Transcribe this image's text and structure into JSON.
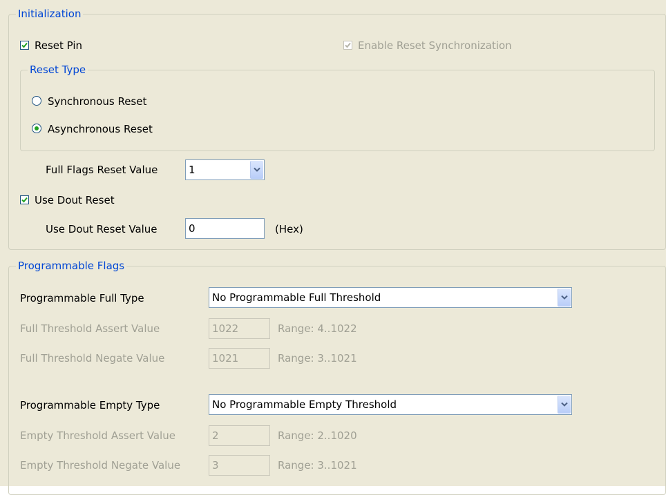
{
  "initialization": {
    "title": "Initialization",
    "reset_pin": {
      "label": "Reset Pin",
      "checked": true
    },
    "enable_reset_sync": {
      "label": "Enable Reset Synchronization",
      "checked": true,
      "disabled": true
    },
    "reset_type": {
      "title": "Reset Type",
      "options": [
        {
          "label": "Synchronous Reset",
          "selected": false
        },
        {
          "label": "Asynchronous Reset",
          "selected": true
        }
      ]
    },
    "full_flags_reset_value": {
      "label": "Full Flags Reset Value",
      "value": "1"
    },
    "use_dout_reset": {
      "label": "Use Dout Reset",
      "checked": true
    },
    "use_dout_reset_value": {
      "label": "Use Dout Reset Value",
      "value": "0",
      "suffix": "(Hex)"
    }
  },
  "programmable_flags": {
    "title": "Programmable Flags",
    "full_type": {
      "label": "Programmable Full Type",
      "value": "No Programmable Full Threshold"
    },
    "full_assert": {
      "label": "Full Threshold Assert Value",
      "value": "1022",
      "range": "Range: 4..1022"
    },
    "full_negate": {
      "label": "Full Threshold Negate Value",
      "value": "1021",
      "range": "Range: 3..1021"
    },
    "empty_type": {
      "label": "Programmable Empty Type",
      "value": "No Programmable Empty Threshold"
    },
    "empty_assert": {
      "label": "Empty Threshold Assert Value",
      "value": "2",
      "range": "Range: 2..1020"
    },
    "empty_negate": {
      "label": "Empty Threshold Negate Value",
      "value": "3",
      "range": "Range: 3..1021"
    }
  },
  "colors": {
    "panel_bg": "#ece9d8",
    "group_title": "#0046d5",
    "disabled_text": "#a0a094",
    "checkmark": "#21a121"
  },
  "icons": [
    "checkbox-checked-icon",
    "radio-selected-icon",
    "radio-unselected-icon",
    "chevron-down-icon"
  ]
}
